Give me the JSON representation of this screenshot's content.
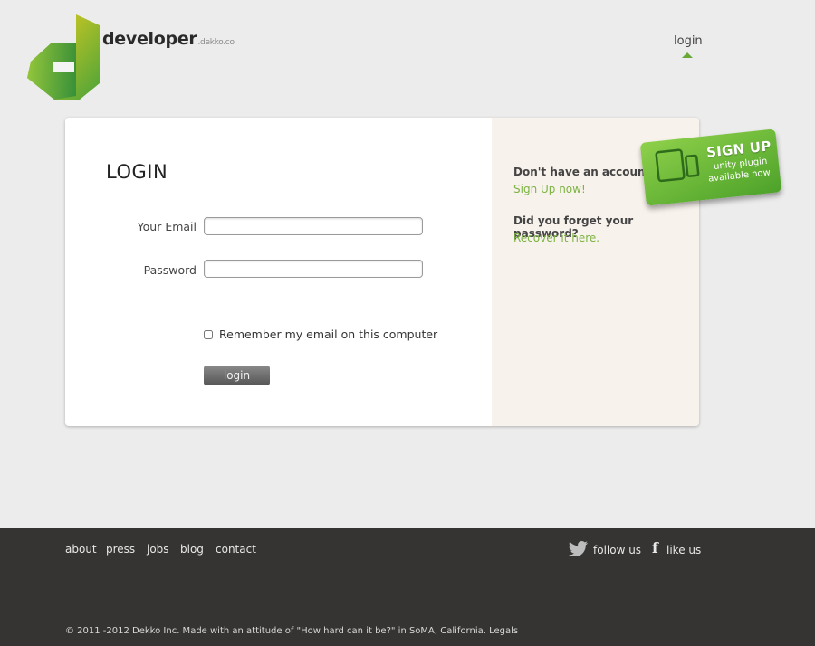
{
  "header": {
    "brand": "developer",
    "brand_sub": ".dekko.co",
    "nav_login": "login"
  },
  "login": {
    "title": "LOGIN",
    "email_label": "Your Email",
    "password_label": "Password",
    "remember_label": "Remember my email on this computer",
    "button_label": "login"
  },
  "side": {
    "q1": "Don't have an account?",
    "link1": "Sign Up now!",
    "q2": "Did you forget your password?",
    "link2": "Recover it here."
  },
  "signup": {
    "title": "SIGN UP",
    "line1": "unity plugin",
    "line2": "available now"
  },
  "footer": {
    "links": [
      "about",
      "press",
      "jobs",
      "blog",
      "contact"
    ],
    "follow": "follow us",
    "like": "like us",
    "copyright": "© 2011 -2012 Dekko Inc. Made with an attitude of \"How hard can it be?\" in SoMA, California. Legals"
  },
  "colors": {
    "accent": "#7cb342",
    "footer_bg": "#353432",
    "side_bg": "#f8f2ec"
  }
}
